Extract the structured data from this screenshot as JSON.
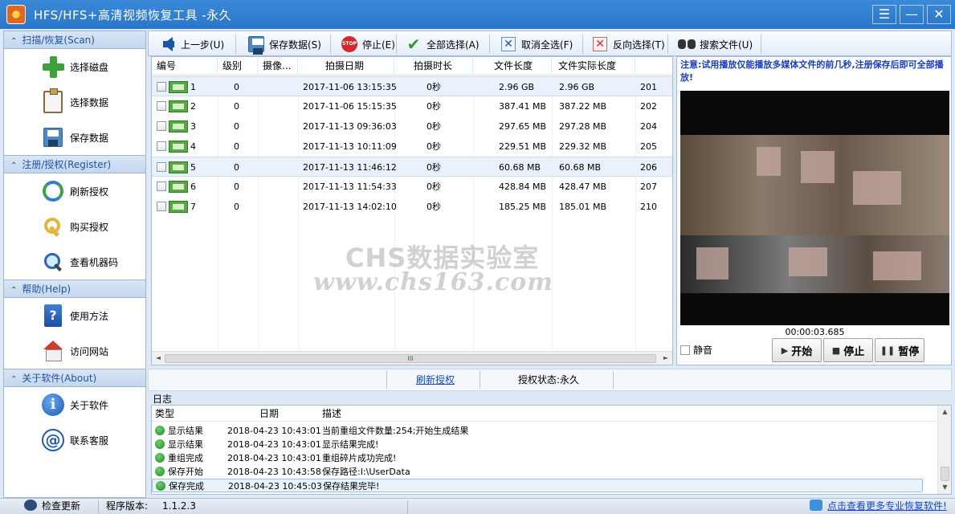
{
  "window": {
    "title": "HFS/HFS+高清视频恢复工具 -永久",
    "controls": {
      "menu": "☰",
      "minimize": "—",
      "close": "✕"
    }
  },
  "sidebar": {
    "sections": [
      {
        "header": "扫描/恢复(Scan)",
        "items": [
          {
            "label": "选择磁盘",
            "icon": "green-plus-icon"
          },
          {
            "label": "选择数据",
            "icon": "clipboard-icon"
          },
          {
            "label": "保存数据",
            "icon": "floppy-icon"
          }
        ]
      },
      {
        "header": "注册/授权(Register)",
        "items": [
          {
            "label": "刷新授权",
            "icon": "refresh-icon"
          },
          {
            "label": "购买授权",
            "icon": "key-icon"
          },
          {
            "label": "查看机器码",
            "icon": "magnifier-icon"
          }
        ]
      },
      {
        "header": "帮助(Help)",
        "items": [
          {
            "label": "使用方法",
            "icon": "help-book-icon"
          },
          {
            "label": "访问网站",
            "icon": "home-globe-icon"
          }
        ]
      },
      {
        "header": "关于软件(About)",
        "items": [
          {
            "label": "关于软件",
            "icon": "info-icon"
          },
          {
            "label": "联系客服",
            "icon": "at-sign-icon"
          }
        ]
      }
    ]
  },
  "toolbar": {
    "back": "上一步(U)",
    "save": "保存数据(S)",
    "stop": "停止(E)",
    "stop_icon_text": "STOP",
    "select_all": "全部选择(A)",
    "deselect_all": "取消全选(F)",
    "invert_select": "反向选择(T)",
    "search": "搜索文件(U)"
  },
  "file_table": {
    "columns": [
      "编号",
      "级别",
      "摄像...",
      "拍摄日期",
      "拍摄时长",
      "文件长度",
      "文件实际长度"
    ],
    "rows": [
      {
        "id": "1",
        "level": "0",
        "camera": "",
        "date": "2017-11-06 13:15:35",
        "duration": "0秒",
        "size": "2.96 GB",
        "actual": "2.96 GB",
        "extra": "201",
        "selected": true
      },
      {
        "id": "2",
        "level": "0",
        "camera": "",
        "date": "2017-11-06 15:15:35",
        "duration": "0秒",
        "size": "387.41 MB",
        "actual": "387.22 MB",
        "extra": "202",
        "selected": false
      },
      {
        "id": "3",
        "level": "0",
        "camera": "",
        "date": "2017-11-13 09:36:03",
        "duration": "0秒",
        "size": "297.65 MB",
        "actual": "297.28 MB",
        "extra": "204",
        "selected": false
      },
      {
        "id": "4",
        "level": "0",
        "camera": "",
        "date": "2017-11-13 10:11:09",
        "duration": "0秒",
        "size": "229.51 MB",
        "actual": "229.32 MB",
        "extra": "205",
        "selected": false
      },
      {
        "id": "5",
        "level": "0",
        "camera": "",
        "date": "2017-11-13 11:46:12",
        "duration": "0秒",
        "size": "60.68 MB",
        "actual": "60.68 MB",
        "extra": "206",
        "selected": true
      },
      {
        "id": "6",
        "level": "0",
        "camera": "",
        "date": "2017-11-13 11:54:33",
        "duration": "0秒",
        "size": "428.84 MB",
        "actual": "428.47 MB",
        "extra": "207",
        "selected": false
      },
      {
        "id": "7",
        "level": "0",
        "camera": "",
        "date": "2017-11-13 14:02:10",
        "duration": "0秒",
        "size": "185.25 MB",
        "actual": "185.01 MB",
        "extra": "210",
        "selected": false
      }
    ],
    "scroll_grip": "III"
  },
  "watermark": {
    "line1": "CHS数据实验室",
    "line2": "www.chs163.com"
  },
  "preview": {
    "notice": "注意:试用播放仅能播放多媒体文件的前几秒,注册保存后即可全部播放!",
    "time": "00:00:03.685",
    "mute": "静音",
    "play": "开始",
    "stop": "停止",
    "pause": "暂停"
  },
  "strip": {
    "refresh_link": "刷新授权",
    "auth_status": "授权状态:永久"
  },
  "log": {
    "label": "日志",
    "columns": [
      "类型",
      "日期",
      "描述"
    ],
    "rows": [
      {
        "type": "显示结果",
        "date": "2018-04-23 10:43:01",
        "desc": "当前重组文件数量:254;开始生成结果",
        "selected": false
      },
      {
        "type": "显示结果",
        "date": "2018-04-23 10:43:01",
        "desc": "显示结果完成!",
        "selected": false
      },
      {
        "type": "重组完成",
        "date": "2018-04-23 10:43:01",
        "desc": "重组碎片成功完成!",
        "selected": false
      },
      {
        "type": "保存开始",
        "date": "2018-04-23 10:43:58",
        "desc": "保存路径:I:\\UserData",
        "selected": false
      },
      {
        "type": "保存完成",
        "date": "2018-04-23 10:45:03",
        "desc": "保存结果完毕!",
        "selected": true
      }
    ]
  },
  "statusbar": {
    "check_update": "检查更新",
    "version_label": "程序版本:",
    "version": "1.1.2.3",
    "more_link": "点击查看更多专业恢复软件!"
  }
}
